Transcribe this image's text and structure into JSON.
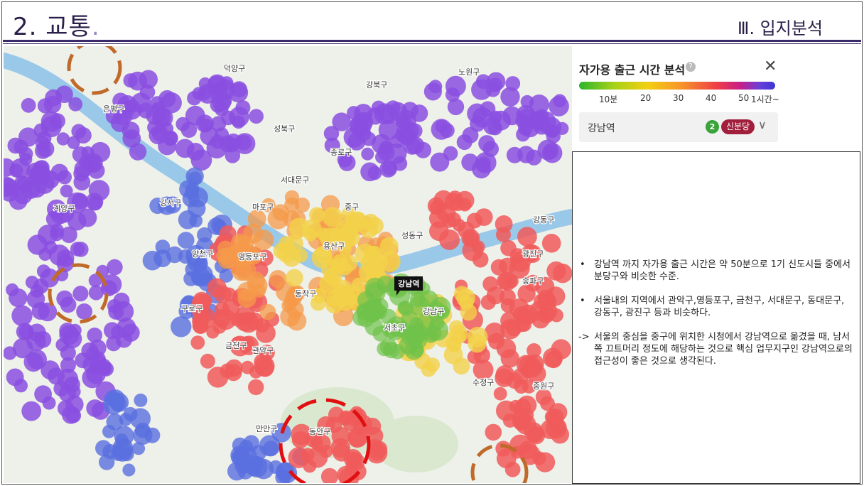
{
  "header": {
    "title": "2. 교통",
    "title_dot": ".",
    "section": "Ⅲ. 입지분석"
  },
  "panel": {
    "title": "자가용 출근 시간 분석",
    "help_icon": "?",
    "close_icon": "✕",
    "legend_ticks": [
      "10분",
      "20",
      "30",
      "40",
      "50",
      "1시간~"
    ],
    "station": "강남역",
    "line_number": "2",
    "line_name": "신분당",
    "chevron_icon": "chevron-down-icon"
  },
  "map": {
    "target_station": "강남역",
    "district_labels": [
      "덕양구",
      "노원구",
      "강북구",
      "은평구",
      "성북구",
      "종로구",
      "서대문구",
      "마포구",
      "중구",
      "용산구",
      "성동구",
      "광진구",
      "강서구",
      "양천구",
      "영등포구",
      "동작구",
      "강남구",
      "송파구",
      "구로구",
      "금천구",
      "관악구",
      "서초구",
      "수정구",
      "중원구",
      "만안구",
      "동안구",
      "계양구",
      "강동구"
    ],
    "colors": {
      "purple": "#8a4fe0",
      "blue": "#5a6fe0",
      "red": "#f05a5a",
      "orange": "#f59a4a",
      "yellow": "#f3d24a",
      "green": "#6fc24a",
      "river": "#8fc3e8"
    }
  },
  "notes": [
    {
      "bullet": "•",
      "text": "강남역 까지 자가용 출근 시간은 약 50분으로 1기 신도시들 중에서 분당구와 비슷한 수준."
    },
    {
      "bullet": "•",
      "text": "서울내의 지역에서 관악구,영등포구, 금천구, 서대문구, 동대문구, 강동구, 광진구 등과 비슷하다."
    },
    {
      "bullet": "->",
      "text": "서울의 중심을 중구에 위치한 시청에서 강남역으로 옮겼을 때, 남서쪽 끄트머리 정도에 해당하는 것으로 핵심 업무지구인 강남역으로의 접근성이 좋은 것으로 생각된다."
    }
  ]
}
